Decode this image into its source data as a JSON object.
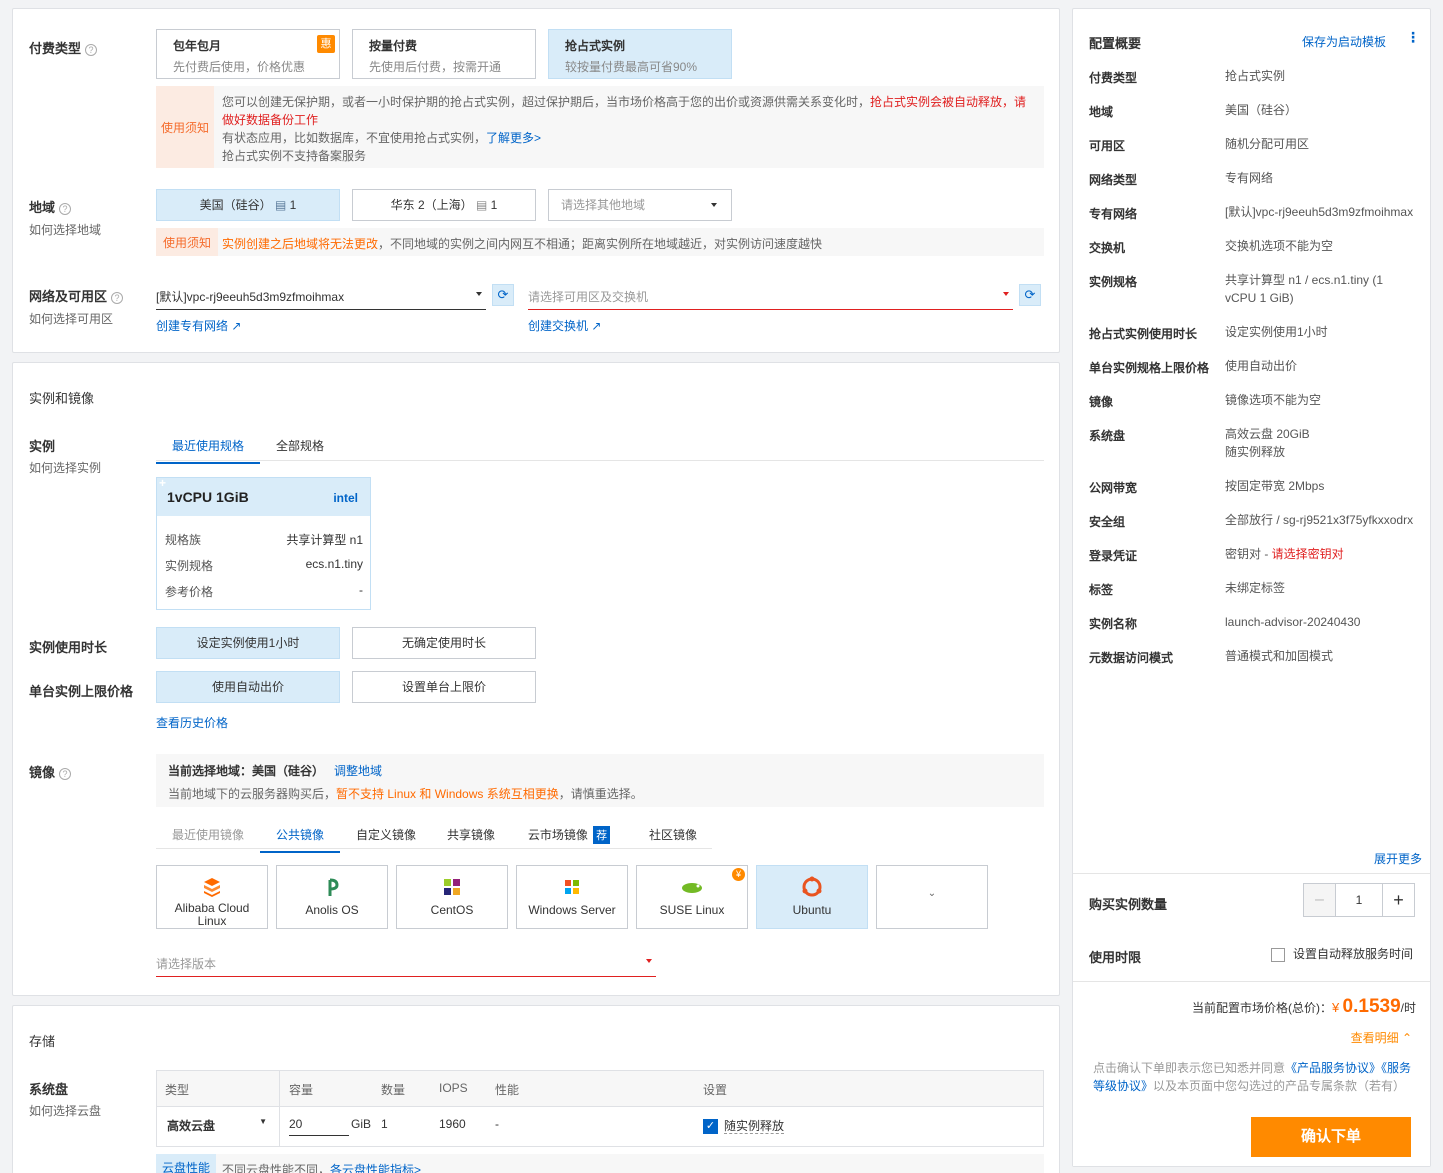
{
  "payment": {
    "label": "付费类型",
    "options": [
      {
        "title": "包年包月",
        "desc": "先付费后使用，价格优惠",
        "badge": "惠"
      },
      {
        "title": "按量付费",
        "desc": "先使用后付费，按需开通"
      },
      {
        "title": "抢占式实例",
        "desc": "较按量付费最高可省90%"
      }
    ],
    "notice_tag": "使用须知",
    "notice_line1": "您可以创建无保护期，或者一小时保护期的抢占式实例，超过保护期后，当市场价格高于您的出价或资源供需关系变化时，",
    "notice_line1_red": "抢占式实例会被自动释放，请做好数据备份工作",
    "notice_line2": "有状态应用，比如数据库，不宜使用抢占式实例，",
    "notice_line2_link": "了解更多>",
    "notice_line3": "抢占式实例不支持备案服务"
  },
  "region": {
    "label": "地域",
    "sub": "如何选择地域",
    "options": [
      {
        "name": "美国（硅谷）",
        "count": "1"
      },
      {
        "name": "华东 2（上海）",
        "count": "1"
      }
    ],
    "other_placeholder": "请选择其他地域",
    "notice_tag": "使用须知",
    "notice_orange": "实例创建之后地域将无法更改",
    "notice_rest": "，不同地域的实例之间内网互不相通；距离实例所在地域越近，对实例访问速度越快"
  },
  "network": {
    "label": "网络及可用区",
    "sub": "如何选择可用区",
    "vpc_value": "[默认]vpc-rj9eeuh5d3m9zfmoihmax",
    "zone_placeholder": "请选择可用区及交换机",
    "create_vpc": "创建专有网络",
    "create_switch": "创建交换机"
  },
  "instance_section": {
    "title": "实例和镜像",
    "instance_label": "实例",
    "instance_sub": "如何选择实例",
    "tabs": [
      "最近使用规格",
      "全部规格"
    ],
    "card": {
      "title": "1vCPU 1GiB",
      "brand": "intel",
      "rows": [
        {
          "k": "规格族",
          "v": "共享计算型 n1"
        },
        {
          "k": "实例规格",
          "v": "ecs.n1.tiny"
        },
        {
          "k": "参考价格",
          "v": "-"
        }
      ]
    },
    "duration_label": "实例使用时长",
    "duration_options": [
      "设定实例使用1小时",
      "无确定使用时长"
    ],
    "price_label": "单台实例上限价格",
    "price_options": [
      "使用自动出价",
      "设置单台上限价"
    ],
    "history_link": "查看历史价格"
  },
  "image": {
    "label": "镜像",
    "current_prefix": "当前选择地域：美国（硅谷）",
    "adjust_link": "调整地域",
    "warn_prefix": "当前地域下的云服务器购买后，",
    "warn_orange": "暂不支持 Linux 和 Windows 系统互相更换",
    "warn_suffix": "，请慎重选择。",
    "tabs": [
      "最近使用镜像",
      "公共镜像",
      "自定义镜像",
      "共享镜像",
      "云市场镜像",
      "社区镜像"
    ],
    "market_badge": "荐",
    "os": [
      "Alibaba Cloud Linux",
      "Anolis OS",
      "CentOS",
      "Windows Server",
      "SUSE Linux",
      "Ubuntu"
    ],
    "suse_badge": "¥",
    "version_placeholder": "请选择版本"
  },
  "storage": {
    "title": "存储",
    "disk_label": "系统盘",
    "disk_sub": "如何选择云盘",
    "headers": [
      "类型",
      "容量",
      "数量",
      "IOPS",
      "性能",
      "设置"
    ],
    "type": "高效云盘",
    "capacity": "20",
    "unit": "GiB",
    "count": "1",
    "iops": "1960",
    "perf": "-",
    "release": "随实例释放",
    "perf_tag": "云盘性能",
    "perf_text": "不同云盘性能不同，",
    "perf_link": "各云盘性能指标>"
  },
  "summary": {
    "title": "配置概要",
    "save_template": "保存为启动模板",
    "rows": [
      {
        "k": "付费类型",
        "v": "抢占式实例"
      },
      {
        "k": "地域",
        "v": "美国（硅谷）"
      },
      {
        "k": "可用区",
        "v": "随机分配可用区"
      },
      {
        "k": "网络类型",
        "v": "专有网络"
      },
      {
        "k": "专有网络",
        "v": "[默认]vpc-rj9eeuh5d3m9zfmoihmax"
      },
      {
        "k": "交换机",
        "v": "交换机选项不能为空"
      },
      {
        "k": "实例规格",
        "v": "共享计算型 n1 / ecs.n1.tiny (1 vCPU 1 GiB)"
      },
      {
        "k": "抢占式实例使用时长",
        "v": "设定实例使用1小时"
      },
      {
        "k": "单台实例规格上限价格",
        "v": "使用自动出价"
      },
      {
        "k": "镜像",
        "v": "镜像选项不能为空"
      },
      {
        "k": "系统盘",
        "v": "高效云盘 20GiB 随实例释放"
      },
      {
        "k": "公网带宽",
        "v": "按固定带宽 2Mbps"
      },
      {
        "k": "安全组",
        "v": "全部放行 / sg-rj9521x3f75yfkxxodrx"
      },
      {
        "k": "登录凭证",
        "v": "密钥对 - ",
        "v_red": "请选择密钥对"
      },
      {
        "k": "标签",
        "v": "未绑定标签"
      },
      {
        "k": "实例名称",
        "v": "launch-advisor-20240430"
      },
      {
        "k": "元数据访问模式",
        "v": "普通模式和加固模式"
      }
    ],
    "expand": "展开更多",
    "qty_label": "购买实例数量",
    "qty": "1",
    "period_label": "使用时限",
    "auto_release": "设置自动释放服务时间",
    "price_label": "当前配置市场价格(总价)：",
    "currency": "¥",
    "price": "0.1539",
    "price_unit": "/时",
    "detail": "查看明细",
    "agree_prefix": "点击确认下单即表示您已知悉并同意",
    "agree_link1": "《产品服务协议》",
    "agree_link2": "《服务等级协议》",
    "agree_suffix": "以及本页面中您勾选过的产品专属条款（若有）",
    "confirm": "确认下单"
  },
  "colors": {
    "accent": "#0064c8",
    "orange": "#ff6a00",
    "selected_bg": "#d9ecf9",
    "error": "#e02020"
  }
}
